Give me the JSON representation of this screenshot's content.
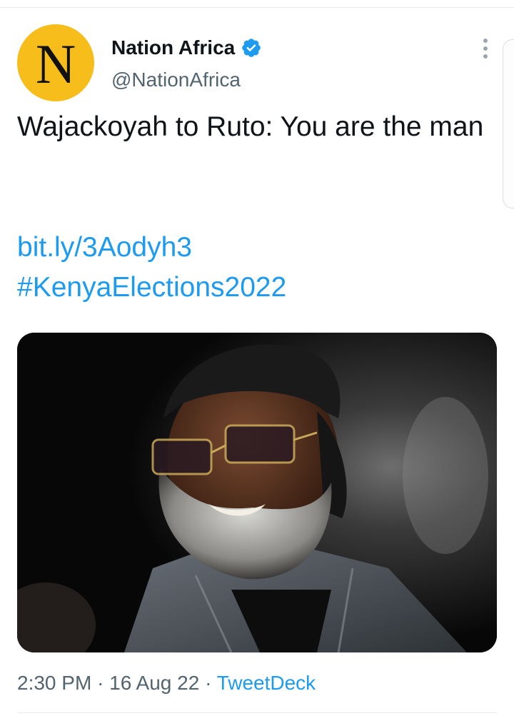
{
  "tweet": {
    "author": {
      "name": "Nation Africa",
      "handle": "@NationAfrica",
      "avatar_letter": "N",
      "avatar_color": "#f6bd1b",
      "verified": true
    },
    "text": "Wajackoyah to Ruto: You are the man",
    "link": "bit.ly/3Aodyh3",
    "hashtag": "#KenyaElections2022",
    "media": {
      "kind": "photo",
      "subject_icon": "photo-portrait"
    },
    "meta": {
      "time": "2:30 PM",
      "separator": "·",
      "date": "16 Aug 22",
      "source": "TweetDeck"
    }
  },
  "colors": {
    "link": "#1d9bf0",
    "secondary_text": "#536471",
    "primary_text": "#0f1419",
    "verified": "#1d9bf0"
  }
}
